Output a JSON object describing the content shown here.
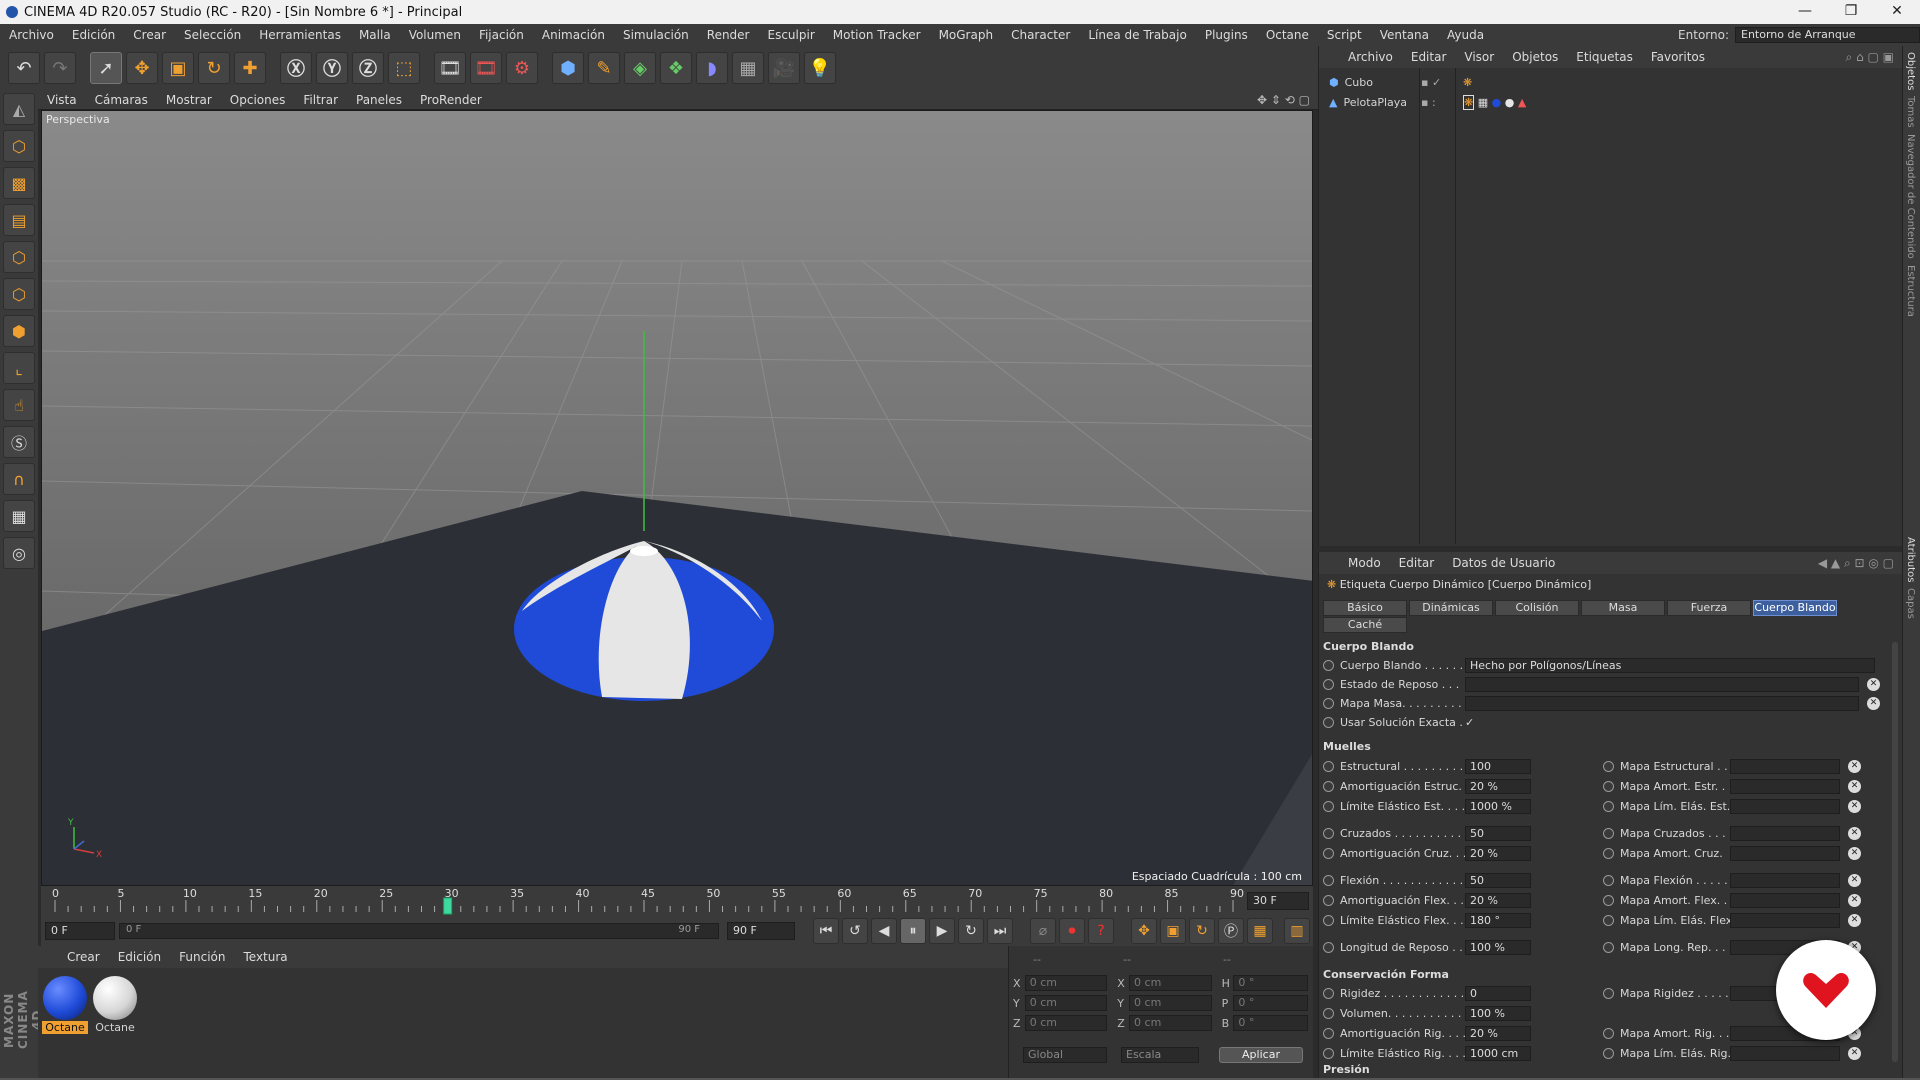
{
  "window": {
    "title": "CINEMA 4D R20.057 Studio (RC - R20) - [Sin Nombre 6 *] - Principal"
  },
  "menubar": {
    "items": [
      "Archivo",
      "Edición",
      "Crear",
      "Selección",
      "Herramientas",
      "Malla",
      "Volumen",
      "Fijación",
      "Animación",
      "Simulación",
      "Render",
      "Esculpir",
      "Motion Tracker",
      "MoGraph",
      "Character",
      "Línea de Trabajo",
      "Plugins",
      "Octane",
      "Script",
      "Ventana",
      "Ayuda"
    ],
    "env_label": "Entorno:",
    "env_value": "Entorno de Arranque"
  },
  "toolbar": {
    "icons": [
      "undo-icon",
      "redo-icon",
      "select-icon",
      "move-icon",
      "scale-icon",
      "rotate-icon",
      "live-select-icon",
      "x-axis-icon",
      "y-axis-icon",
      "z-axis-icon",
      "world-coord-icon",
      "render-view-icon",
      "render-pv-icon",
      "render-settings-icon",
      "cube-icon",
      "pen-icon",
      "subdivision-icon",
      "array-icon",
      "deformer-icon",
      "floor-icon",
      "camera-icon",
      "light-icon"
    ]
  },
  "viewport": {
    "menu": [
      "Vista",
      "Cámaras",
      "Mostrar",
      "Opciones",
      "Filtrar",
      "Paneles",
      "ProRender"
    ],
    "label": "Perspectiva",
    "grid_label": "Espaciado Cuadrícula : 100 cm"
  },
  "timeline": {
    "ticks": [
      "0",
      "5",
      "10",
      "15",
      "20",
      "25",
      "30",
      "35",
      "40",
      "45",
      "50",
      "55",
      "60",
      "65",
      "70",
      "75",
      "80",
      "85",
      "90"
    ],
    "current_frame": 30,
    "end_label": "30 F",
    "start_field": "0 F",
    "range_start": "0 F",
    "range_end": "90 F",
    "end_field": "90 F"
  },
  "materials": {
    "menu": [
      "Crear",
      "Edición",
      "Función",
      "Textura"
    ],
    "items": [
      {
        "name": "Octane",
        "color": "#1f4bd8"
      },
      {
        "name": "Octane",
        "color": "#e6e6e6"
      }
    ]
  },
  "coords": {
    "rows": [
      {
        "a": "X",
        "av": "0 cm",
        "b": "X",
        "bv": "0 cm",
        "c": "H",
        "cv": "0 °"
      },
      {
        "a": "Y",
        "av": "0 cm",
        "b": "Y",
        "bv": "0 cm",
        "c": "P",
        "cv": "0 °"
      },
      {
        "a": "Z",
        "av": "0 cm",
        "b": "Z",
        "bv": "0 cm",
        "c": "B",
        "cv": "0 °"
      }
    ],
    "space": "Global",
    "mode": "Escala",
    "apply": "Aplicar",
    "header1": "--",
    "header2": "--",
    "header3": "--"
  },
  "objects": {
    "menu": [
      "Archivo",
      "Editar",
      "Visor",
      "Objetos",
      "Etiquetas",
      "Favoritos"
    ],
    "items": [
      "Cubo",
      "PelotaPlaya"
    ]
  },
  "attributes": {
    "menu": [
      "Modo",
      "Editar",
      "Datos de Usuario"
    ],
    "title": "Etiqueta Cuerpo Dinámico [Cuerpo Dinámico]",
    "tabs": [
      "Básico",
      "Dinámicas",
      "Colisión",
      "Masa",
      "Fuerza",
      "Cuerpo Blando",
      "Caché"
    ],
    "sec_soft": "Cuerpo Blando",
    "soft_label": "Cuerpo Blando . . . . . .",
    "soft_value": "Hecho por Polígonos/Líneas",
    "rest_label": "Estado de Reposo . . .",
    "massmap_label": "Mapa Masa. . . . . . . . .",
    "exact_label": "Usar Solución Exacta .",
    "exact_check": "✓",
    "sec_springs": "Muelles",
    "springs": [
      {
        "l": "Estructural . . . . . . . . .",
        "v": "100",
        "m": "Mapa Estructural . . ."
      },
      {
        "l": "Amortiguación Estruc.",
        "v": "20 %",
        "m": "Mapa Amort. Estr. . ."
      },
      {
        "l": "Límite Elástico Est. . . . .",
        "v": "1000 %",
        "m": "Mapa Lím. Elás. Est."
      },
      {
        "l": "Cruzados . . . . . . . . . . .",
        "v": "50",
        "m": "Mapa Cruzados . . . ."
      },
      {
        "l": "Amortiguación Cruz. . .",
        "v": "20 %",
        "m": "Mapa Amort. Cruz."
      },
      {
        "l": "Flexión . . . . . . . . . . . .",
        "v": "50",
        "m": "Mapa Flexión . . . . ."
      },
      {
        "l": "Amortiguación Flex. . .",
        "v": "20 %",
        "m": "Mapa Amort. Flex. . ."
      },
      {
        "l": "Límite Elástico Flex. . . .",
        "v": "180 °",
        "m": "Mapa Lím. Elás. Flex."
      },
      {
        "l": "Longitud de Reposo . .",
        "v": "100 %",
        "m": "Mapa Long. Rep. . . ."
      }
    ],
    "sec_shape": "Conservación Forma",
    "shape": [
      {
        "l": "Rigidez . . . . . . . . . . . .",
        "v": "0",
        "m": "Mapa Rigidez . . . . . ."
      },
      {
        "l": "Volumen. . . . . . . . . . . .",
        "v": "100 %",
        "m": ""
      },
      {
        "l": "Amortiguación Rig. . . .",
        "v": "20 %",
        "m": "Mapa Amort. Rig. . . ."
      },
      {
        "l": "Límite Elástico Rig. . . .",
        "v": "1000 cm",
        "m": "Mapa Lím. Elás. Rig."
      }
    ],
    "sec_pressure": "Presión"
  },
  "sidetabs": [
    "Objetos",
    "Tomas",
    "Navegador de Contenido",
    "Estructura",
    "Atributos",
    "Capas"
  ],
  "colors": {
    "accent": "#3d5f9e",
    "ui_bg": "#333333",
    "ball_blue": "#1f4bd8",
    "ball_white": "#e8e8e8"
  },
  "logo": {
    "name": "heart-logo-icon"
  }
}
